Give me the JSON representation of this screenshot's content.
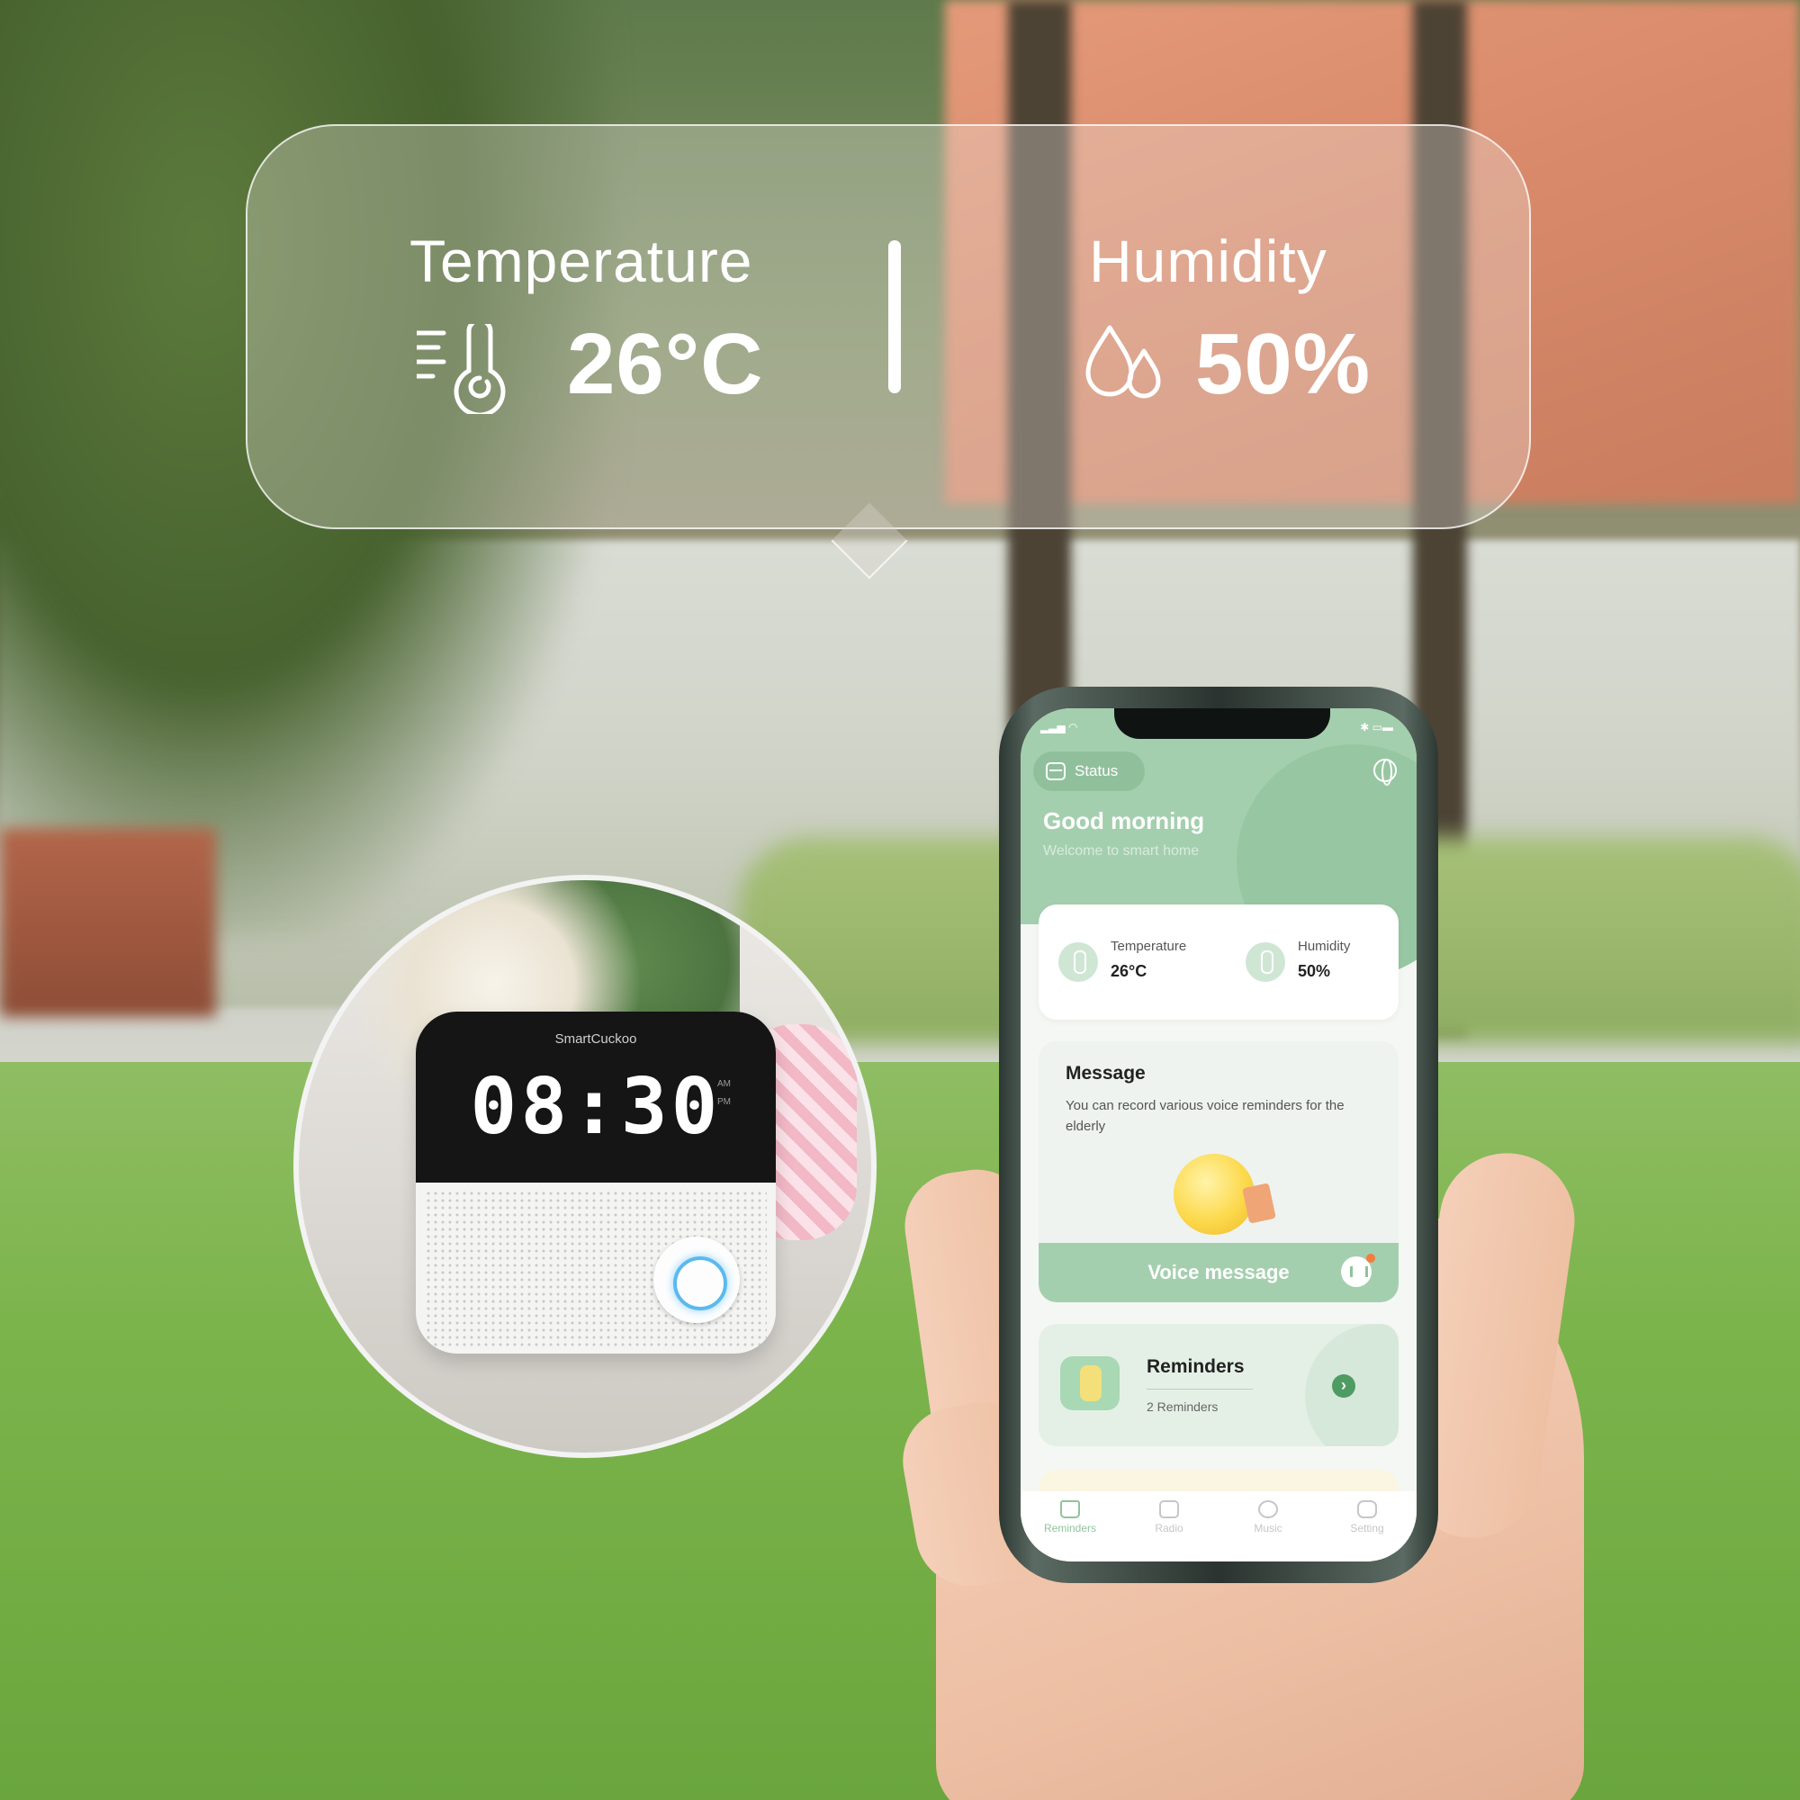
{
  "bubble": {
    "temperature_label": "Temperature",
    "temperature_value": "26°C",
    "humidity_label": "Humidity",
    "humidity_value": "50%"
  },
  "product": {
    "brand": "SmartCuckoo",
    "time": "08:30",
    "am": "AM",
    "pm": "PM"
  },
  "app": {
    "status_chip": "Status",
    "greeting": "Good morning",
    "welcome": "Welcome to smart home",
    "sensors": {
      "temperature_label": "Temperature",
      "temperature_value": "26°C",
      "humidity_label": "Humidity",
      "humidity_value": "50%"
    },
    "message": {
      "title": "Message",
      "description": "You can record various voice reminders for the elderly",
      "voice_button": "Voice message"
    },
    "reminders": {
      "title": "Reminders",
      "count_label": "2 Reminders"
    },
    "tabs": [
      {
        "label": "Reminders",
        "icon": "home-icon",
        "active": true
      },
      {
        "label": "Radio",
        "icon": "radio-icon",
        "active": false
      },
      {
        "label": "Music",
        "icon": "music-icon",
        "active": false
      },
      {
        "label": "Setting",
        "icon": "gear-icon",
        "active": false
      }
    ],
    "colors": {
      "accent_green": "#a4cfae",
      "dark_green": "#4e9c62",
      "notification_dot": "#f47c3c"
    }
  }
}
